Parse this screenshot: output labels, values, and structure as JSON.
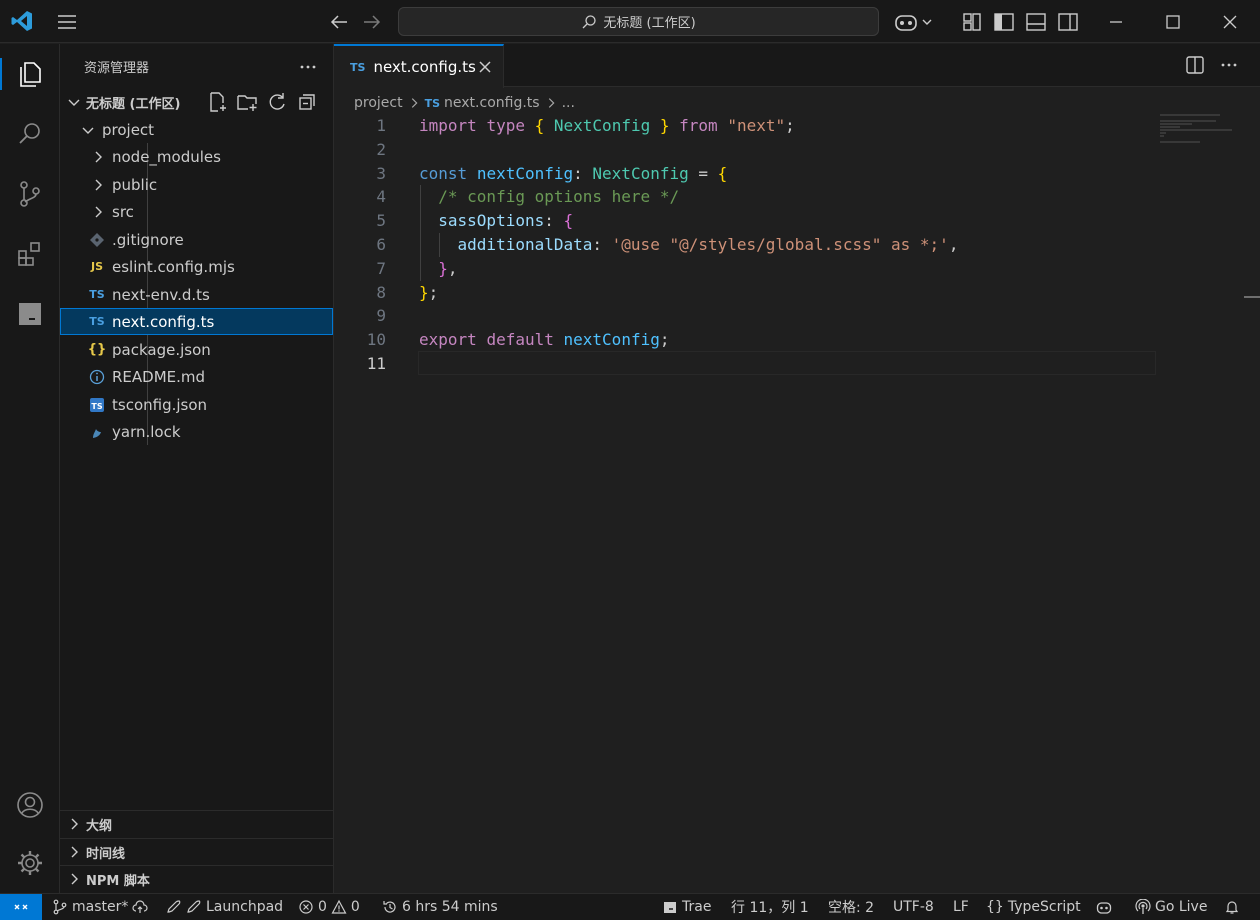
{
  "titlebar": {
    "search_text": "无标题 (工作区)"
  },
  "sidebar": {
    "title": "资源管理器",
    "workspace_label": "无标题 (工作区)",
    "tree": [
      {
        "label": "project",
        "type": "folder-open"
      },
      {
        "label": "node_modules",
        "type": "folder"
      },
      {
        "label": "public",
        "type": "folder"
      },
      {
        "label": "src",
        "type": "folder"
      },
      {
        "label": ".gitignore",
        "type": "git"
      },
      {
        "label": "eslint.config.mjs",
        "type": "js"
      },
      {
        "label": "next-env.d.ts",
        "type": "ts"
      },
      {
        "label": "next.config.ts",
        "type": "ts"
      },
      {
        "label": "package.json",
        "type": "json"
      },
      {
        "label": "README.md",
        "type": "info"
      },
      {
        "label": "tsconfig.json",
        "type": "tsconfig"
      },
      {
        "label": "yarn.lock",
        "type": "yarn"
      }
    ],
    "panels": [
      "大纲",
      "时间线",
      "NPM 脚本"
    ]
  },
  "editor": {
    "tab_label": "next.config.ts",
    "tab_badge": "TS",
    "breadcrumb": [
      "project",
      "next.config.ts",
      "..."
    ],
    "line_numbers": [
      "1",
      "2",
      "3",
      "4",
      "5",
      "6",
      "7",
      "8",
      "9",
      "10",
      "11"
    ]
  },
  "statusbar": {
    "branch": "master*",
    "launchpad": "Launchpad",
    "errors": "0",
    "warnings": "0",
    "time": "6 hrs 54 mins",
    "trae": "Trae",
    "position": "行 11，列 1",
    "spaces": "空格: 2",
    "encoding": "UTF-8",
    "eol": "LF",
    "language": "TypeScript",
    "golive": "Go Live"
  },
  "colors": {
    "accent": "#0078d4",
    "background": "#1f1f1f",
    "sidebar": "#181818"
  },
  "icons": [
    "vscode-logo-icon",
    "menu-icon",
    "back-arrow-icon",
    "forward-arrow-icon",
    "search-icon",
    "copilot-icon",
    "layout-icons",
    "explorer-icon",
    "search-view-icon",
    "source-control-icon",
    "extensions-icon",
    "panel-icon",
    "account-icon",
    "gear-icon",
    "bell-icon"
  ]
}
